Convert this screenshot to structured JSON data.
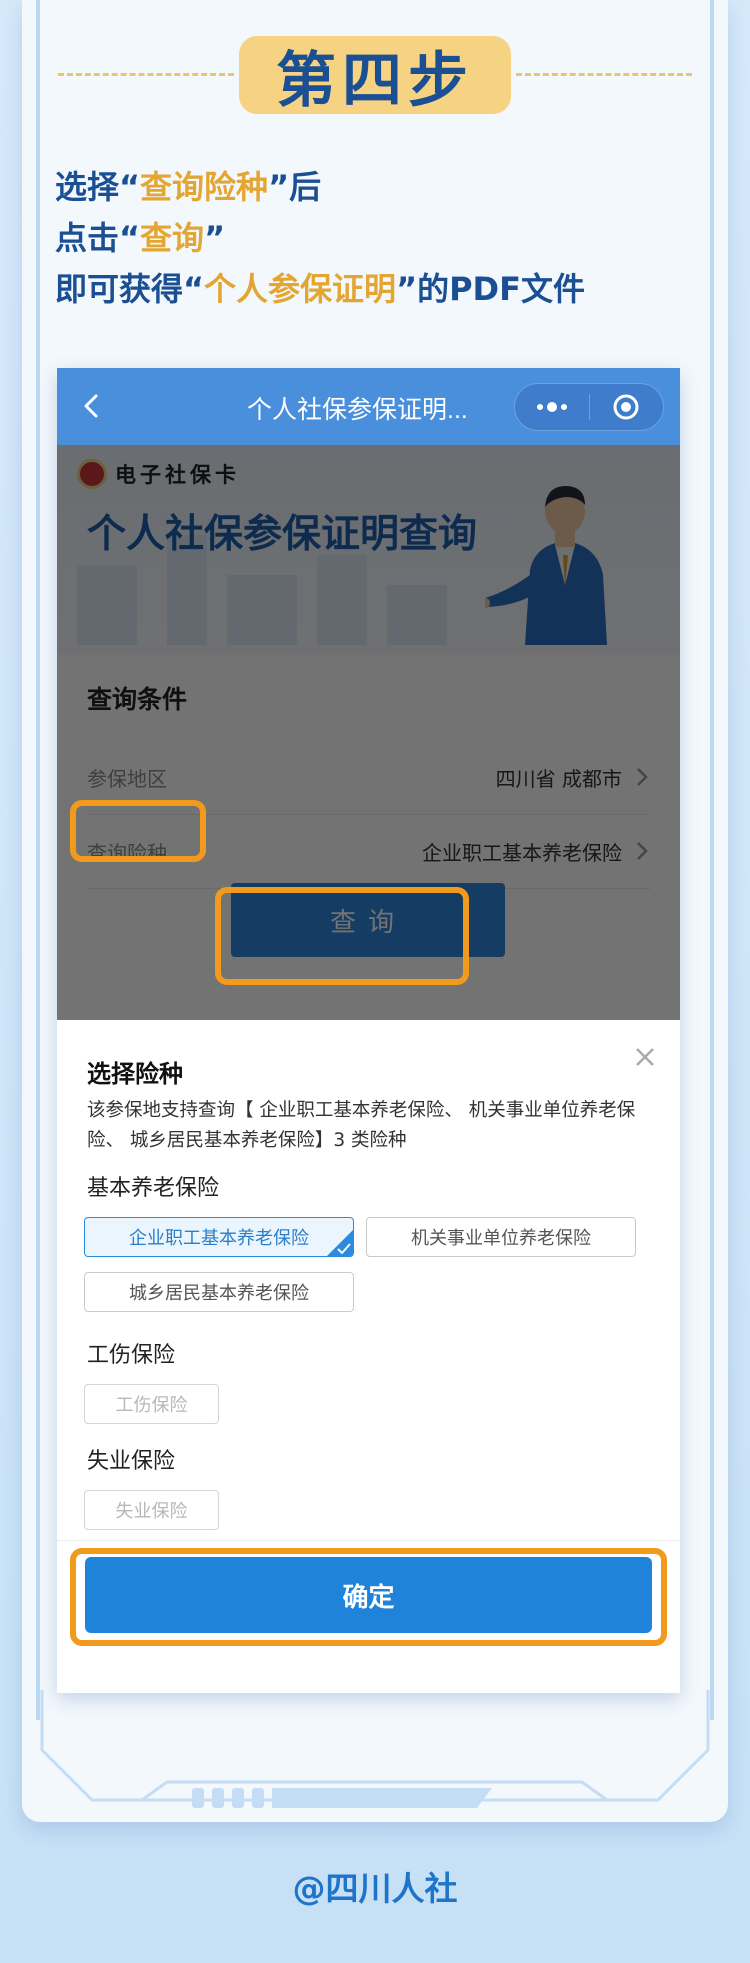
{
  "step": {
    "badge": "第四步"
  },
  "intro": {
    "line1_pre": "选择“",
    "line1_hl": "查询险种",
    "line1_post": "”后",
    "line2_pre": "点击“",
    "line2_hl": "查询",
    "line2_post": "”",
    "line3_pre": "即可获得“",
    "line3_hl": "个人参保证明",
    "line3_post": "”的PDF文件"
  },
  "miniprogram": {
    "nav_title": "个人社保参保证明...",
    "logo_text": "电子社保卡",
    "hero_title": "个人社保参保证明查询",
    "section_title": "查询条件",
    "rows": [
      {
        "label": "参保地区",
        "value": "四川省 成都市"
      },
      {
        "label": "查询险种",
        "value": "企业职工基本养老保险"
      }
    ],
    "query_button": "查询"
  },
  "sheet": {
    "title": "选择险种",
    "description": "该参保地支持查询【 企业职工基本养老保险、 机关事业单位养老保险、 城乡居民基本养老保险】3 类险种",
    "sections": [
      {
        "title": "基本养老保险",
        "options": [
          "企业职工基本养老保险",
          "机关事业单位养老保险",
          "城乡居民基本养老保险"
        ],
        "selected": "企业职工基本养老保险"
      },
      {
        "title": "工伤保险",
        "options": [
          "工伤保险"
        ]
      },
      {
        "title": "失业保险",
        "options": [
          "失业保险"
        ]
      }
    ],
    "confirm_button": "确定"
  },
  "footer": "@四川人社",
  "colors": {
    "accent_orange": "#f29a1c",
    "title_blue": "#1b4f93",
    "highlight_gold": "#e3a632",
    "primary_button": "#1f83d9"
  }
}
